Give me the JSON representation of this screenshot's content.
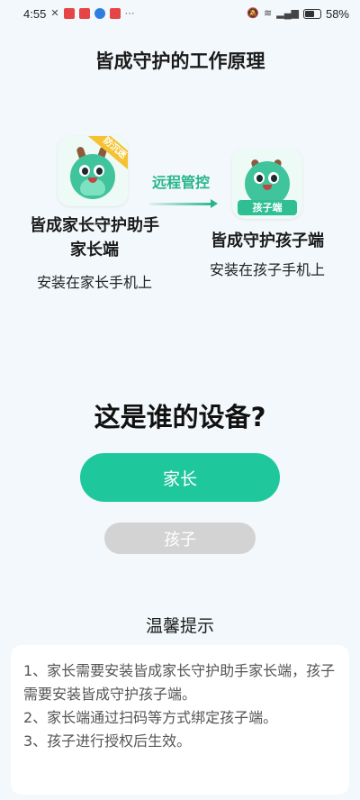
{
  "status_bar": {
    "time": "4:55",
    "battery_percent": "58%",
    "notification_icons": [
      "network-icon",
      "app-icon-1",
      "app-icon-2",
      "app-icon-3",
      "app-icon-4",
      "more-icon"
    ]
  },
  "page": {
    "title": "皆成守护的工作原理"
  },
  "diagram": {
    "parent_app": {
      "badge": "防沉迷",
      "name": "皆成家长守护助手\n家长端",
      "install_hint": "安装在家长手机上"
    },
    "arrow_label": "远程管控",
    "child_app": {
      "badge": "孩子端",
      "name": "皆成守护孩子端",
      "install_hint": "安装在孩子手机上"
    }
  },
  "question": "这是谁的设备?",
  "buttons": {
    "parent": "家长",
    "child": "孩子"
  },
  "tips": {
    "title": "温馨提示",
    "lines": [
      "1、家长需要安装皆成家长守护助手家长端，孩子需要安装皆成守护孩子端。",
      "2、家长端通过扫码等方式绑定孩子端。",
      "3、孩子进行授权后生效。"
    ]
  },
  "colors": {
    "accent": "#1fc79c",
    "disabled_button": "#d3d3d3",
    "background": "#f2f8fb"
  }
}
